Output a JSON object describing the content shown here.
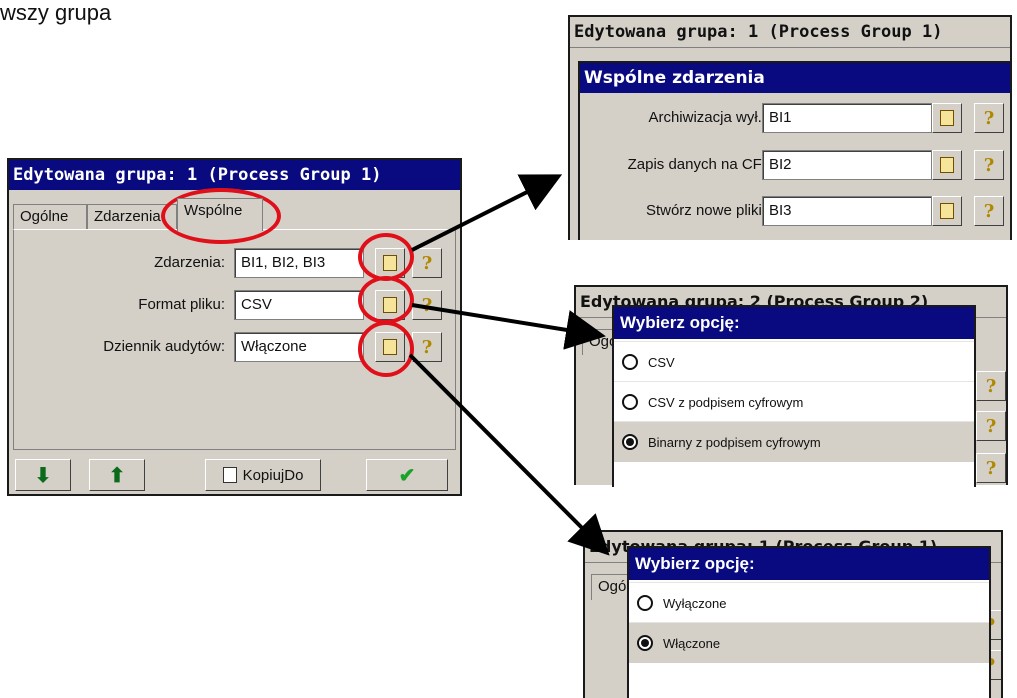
{
  "caption": "wszy grupa",
  "main_panel": {
    "title": "Edytowana grupa: 1 (Process Group 1)",
    "tabs": [
      "Ogólne",
      "Zdarzenia",
      "Wspólne"
    ],
    "rows": [
      {
        "label": "Zdarzenia:",
        "value": "BI1, BI2, BI3"
      },
      {
        "label": "Format pliku:",
        "value": "CSV"
      },
      {
        "label": "Dziennik audytów:",
        "value": "Włączone"
      }
    ],
    "copy_button": "KopiujDo"
  },
  "events_panel": {
    "title": "Edytowana grupa: 1 (Process Group 1)",
    "subtitle": "Wspólne zdarzenia",
    "rows": [
      {
        "label": "Archiwizacja wył.:",
        "value": "BI1"
      },
      {
        "label": "Zapis danych na CF:",
        "value": "BI2"
      },
      {
        "label": "Stwórz nowe pliki:",
        "value": "BI3"
      }
    ]
  },
  "format_dialog": {
    "bg_title": "Edytowana grupa: 2 (Process Group 2)",
    "bg_tab": "Ogó",
    "title": "Wybierz opcję:",
    "options": [
      "CSV",
      "CSV z podpisem cyfrowym",
      "Binarny z podpisem cyfrowym"
    ],
    "selected_index": 2
  },
  "audit_dialog": {
    "bg_title": "Edytowana grupa: 1 (Process Group 1)",
    "bg_tab": "Ogó",
    "title": "Wybierz opcję:",
    "options": [
      "Wyłączone",
      "Włączone"
    ],
    "selected_index": 1
  },
  "colors": {
    "titlebar": "#0a0a80",
    "highlight": "#e0101a",
    "panel": "#d4d0c8"
  }
}
